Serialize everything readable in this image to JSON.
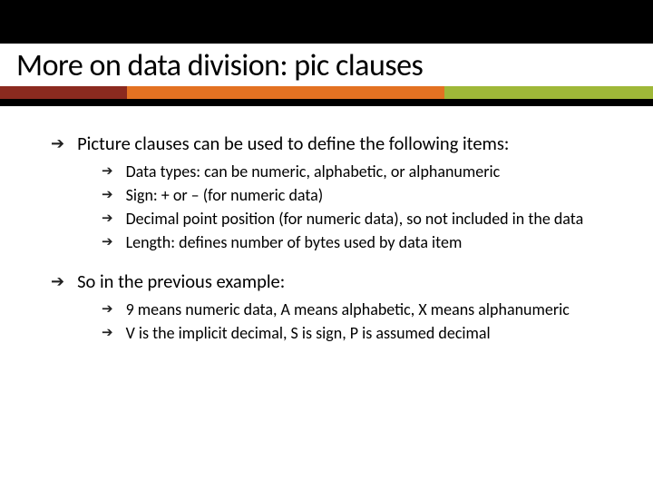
{
  "slide": {
    "title": "More on data division: pic clauses",
    "bullets": [
      {
        "text": "Picture clauses can be used to define the following items:",
        "sub": [
          "Data types: can be numeric, alphabetic, or alphanumeric",
          "Sign: + or – (for numeric data)",
          "Decimal point position (for numeric data), so not included in the data",
          "Length: defines number of bytes used by data item"
        ]
      },
      {
        "text": "So in the previous example:",
        "sub": [
          "9 means numeric data, A means alphabetic, X means alphanumeric",
          "V is the implicit decimal, S is sign, P is assumed decimal"
        ]
      }
    ]
  },
  "colors": {
    "accent_red": "#8b2a1f",
    "accent_orange": "#e37222",
    "accent_green": "#9fb838"
  }
}
